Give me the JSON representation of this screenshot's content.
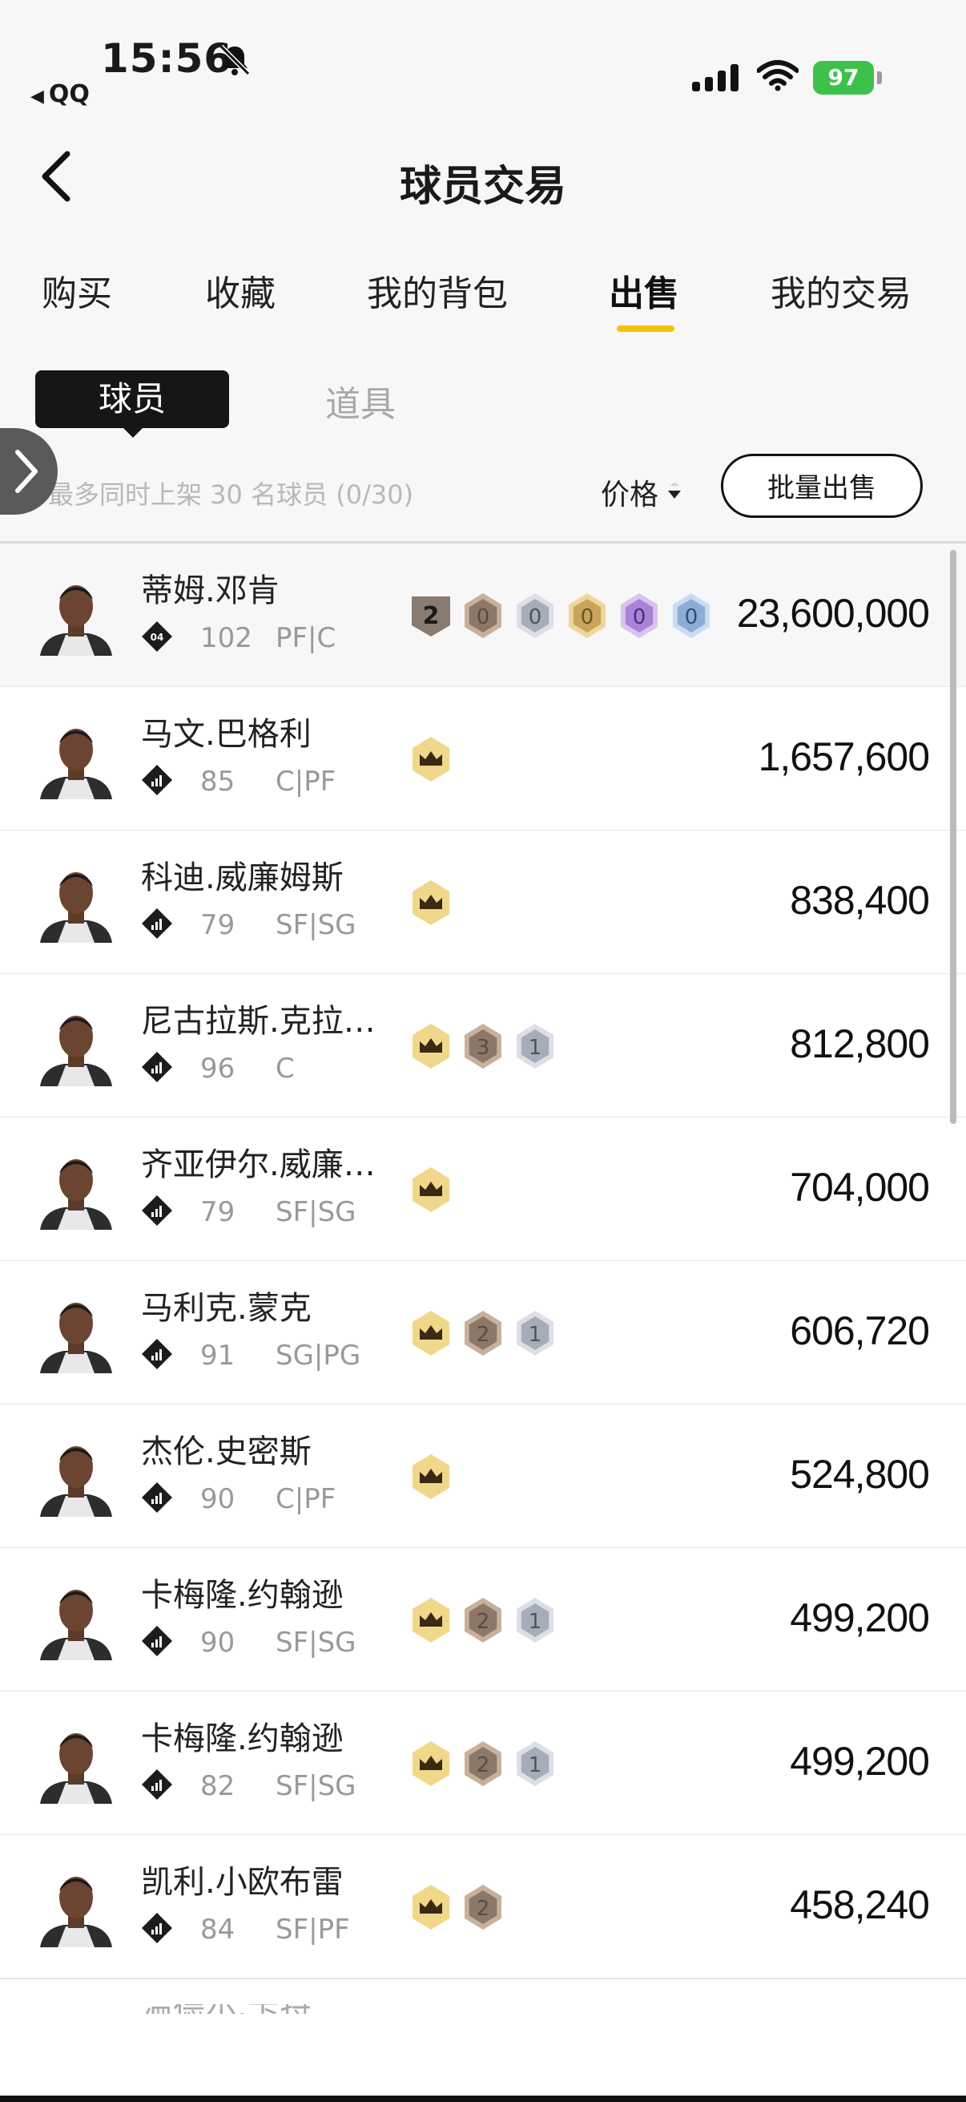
{
  "status": {
    "time": "15:56",
    "back_app": "QQ",
    "battery": "97"
  },
  "nav": {
    "title": "球员交易"
  },
  "tabs": [
    {
      "label": "购买",
      "active": false
    },
    {
      "label": "收藏",
      "active": false
    },
    {
      "label": "我的背包",
      "active": false
    },
    {
      "label": "出售",
      "active": true
    },
    {
      "label": "我的交易",
      "active": false
    }
  ],
  "subtabs": {
    "players": "球员",
    "props": "道具"
  },
  "toolbar": {
    "limit_text": "最多同时上架 30 名球员 (0/30)",
    "sort_label": "价格",
    "bulk_sell": "批量出售"
  },
  "colors": {
    "accent": "#f5c400",
    "price": "#111111"
  },
  "players": [
    {
      "name": "蒂姆.邓肯",
      "rank": "04",
      "rating": "102",
      "pos": "PF|C",
      "price": "23,600,000",
      "badges": [
        {
          "type": "rank",
          "text": "2"
        },
        {
          "type": "bronze",
          "text": "0"
        },
        {
          "type": "silver",
          "text": "0"
        },
        {
          "type": "gold",
          "text": "0"
        },
        {
          "type": "purple",
          "text": "0"
        },
        {
          "type": "blue",
          "text": "0"
        }
      ]
    },
    {
      "name": "马文.巴格利",
      "rating": "85",
      "pos": "C|PF",
      "price": "1,657,600",
      "badges": [
        {
          "type": "crown",
          "text": ""
        }
      ]
    },
    {
      "name": "科迪.威廉姆斯",
      "rating": "79",
      "pos": "SF|SG",
      "price": "838,400",
      "badges": [
        {
          "type": "crown",
          "text": ""
        }
      ]
    },
    {
      "name": "尼古拉斯.克拉…",
      "rating": "96",
      "pos": "C",
      "price": "812,800",
      "badges": [
        {
          "type": "crown",
          "text": ""
        },
        {
          "type": "bronze",
          "text": "3"
        },
        {
          "type": "silver",
          "text": "1"
        }
      ]
    },
    {
      "name": "齐亚伊尔.威廉…",
      "rating": "79",
      "pos": "SF|SG",
      "price": "704,000",
      "badges": [
        {
          "type": "crown",
          "text": ""
        }
      ]
    },
    {
      "name": "马利克.蒙克",
      "rating": "91",
      "pos": "SG|PG",
      "price": "606,720",
      "badges": [
        {
          "type": "crown",
          "text": ""
        },
        {
          "type": "bronze",
          "text": "2"
        },
        {
          "type": "silver",
          "text": "1"
        }
      ]
    },
    {
      "name": "杰伦.史密斯",
      "rating": "90",
      "pos": "C|PF",
      "price": "524,800",
      "badges": [
        {
          "type": "crown",
          "text": ""
        }
      ]
    },
    {
      "name": "卡梅隆.约翰逊",
      "rating": "90",
      "pos": "SF|SG",
      "price": "499,200",
      "badges": [
        {
          "type": "crown",
          "text": ""
        },
        {
          "type": "bronze",
          "text": "2"
        },
        {
          "type": "silver",
          "text": "1"
        }
      ]
    },
    {
      "name": "卡梅隆.约翰逊",
      "rating": "82",
      "pos": "SF|SG",
      "price": "499,200",
      "badges": [
        {
          "type": "crown",
          "text": ""
        },
        {
          "type": "bronze",
          "text": "2"
        },
        {
          "type": "silver",
          "text": "1"
        }
      ]
    },
    {
      "name": "凯利.小欧布雷",
      "rating": "84",
      "pos": "SF|PF",
      "price": "458,240",
      "badges": [
        {
          "type": "crown",
          "text": ""
        },
        {
          "type": "bronze",
          "text": "2"
        }
      ]
    }
  ],
  "next_row_partial": "温德尔.卡特"
}
